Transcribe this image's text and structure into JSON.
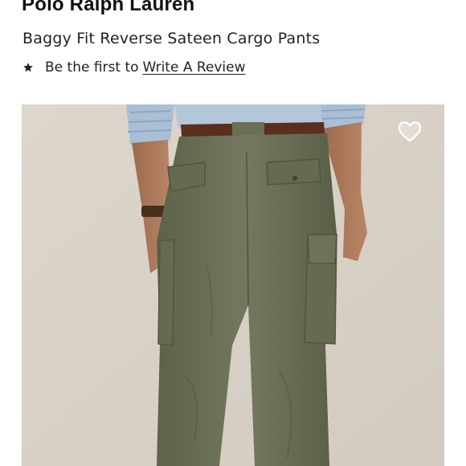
{
  "brand": "Polo Ralph Lauren",
  "product": {
    "title": "Baggy Fit Reverse Sateen Cargo Pants"
  },
  "review": {
    "lead_text": "Be the first to",
    "link_text": "Write A Review"
  },
  "image": {
    "subject": "olive cargo pants back view",
    "favorite_icon": "heart-outline-icon"
  },
  "colors": {
    "pants": "#6e7358",
    "background": "#d9d2c7"
  }
}
